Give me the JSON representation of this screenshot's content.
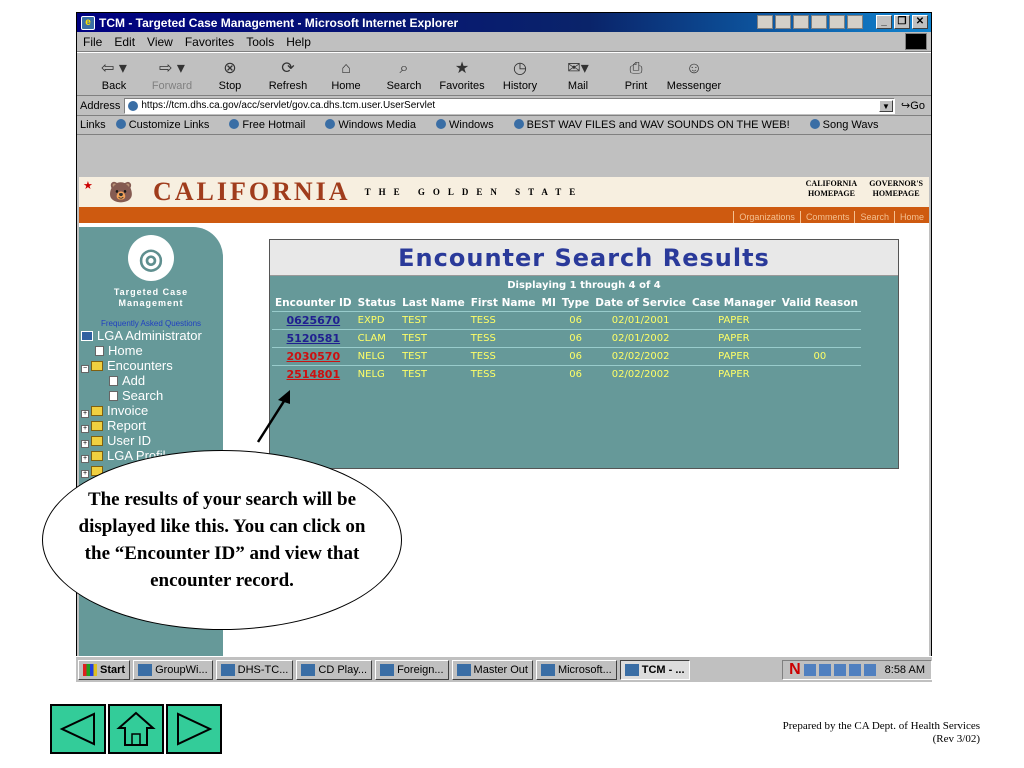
{
  "window": {
    "title": "TCM - Targeted Case Management - Microsoft Internet Explorer"
  },
  "menu": [
    "File",
    "Edit",
    "View",
    "Favorites",
    "Tools",
    "Help"
  ],
  "toolbar": {
    "back": "Back",
    "forward": "Forward",
    "stop": "Stop",
    "refresh": "Refresh",
    "home": "Home",
    "search": "Search",
    "favorites": "Favorites",
    "history": "History",
    "mail": "Mail",
    "print": "Print",
    "messenger": "Messenger"
  },
  "address": {
    "label": "Address",
    "url": "https://tcm.dhs.ca.gov/acc/servlet/gov.ca.dhs.tcm.user.UserServlet",
    "go": "Go"
  },
  "links": {
    "label": "Links",
    "items": [
      "Customize Links",
      "Free Hotmail",
      "Windows Media",
      "Windows",
      "BEST WAV FILES and WAV SOUNDS ON THE WEB!",
      "Song Wavs"
    ]
  },
  "header": {
    "title": "CALIFORNIA",
    "subtitle": "THE GOLDEN STATE",
    "link1_line1": "CALIFORNIA",
    "link1_line2": "HOMEPAGE",
    "link2_line1": "GOVERNOR'S",
    "link2_line2": "HOMEPAGE",
    "nav": [
      "Organizations",
      "Comments",
      "Search",
      "Home"
    ]
  },
  "sidebar": {
    "title_line1": "Targeted Case",
    "title_line2": "Management",
    "faq": "Frequently Asked Questions",
    "items": {
      "admin": "LGA Administrator",
      "home": "Home",
      "encounters": "Encounters",
      "add": "Add",
      "search": "Search",
      "invoice": "Invoice",
      "report": "Report",
      "userid": "User ID",
      "lgaprofile": "LGA Profil"
    }
  },
  "results": {
    "title": "Encounter Search Results",
    "subtitle": "Displaying 1 through 4 of 4",
    "columns": [
      "Encounter ID",
      "Status",
      "Last Name",
      "First Name",
      "MI",
      "Type",
      "Date of Service",
      "Case Manager",
      "Valid Reason"
    ],
    "rows": [
      {
        "id": "0625670",
        "status": "EXPD",
        "last": "TEST",
        "first": "TESS",
        "mi": "",
        "type": "06",
        "date": "02/01/2001",
        "manager": "PAPER",
        "reason": ""
      },
      {
        "id": "5120581",
        "status": "CLAM",
        "last": "TEST",
        "first": "TESS",
        "mi": "",
        "type": "06",
        "date": "02/01/2002",
        "manager": "PAPER",
        "reason": ""
      },
      {
        "id": "2030570",
        "status": "NELG",
        "last": "TEST",
        "first": "TESS",
        "mi": "",
        "type": "06",
        "date": "02/02/2002",
        "manager": "PAPER",
        "reason": "00"
      },
      {
        "id": "2514801",
        "status": "NELG",
        "last": "TEST",
        "first": "TESS",
        "mi": "",
        "type": "06",
        "date": "02/02/2002",
        "manager": "PAPER",
        "reason": ""
      }
    ]
  },
  "callout": {
    "text": "The results of your search will be displayed like this. You can click on the “Encounter ID” and view that encounter record."
  },
  "taskbar": {
    "start": "Start",
    "tasks": [
      "GroupWi...",
      "DHS-TC...",
      "CD Play...",
      "Foreign...",
      "Master Out",
      "Microsoft...",
      "TCM - ..."
    ],
    "clock": "8:58 AM"
  },
  "footer": {
    "line1": "Prepared by the CA Dept. of Health Services",
    "line2": "(Rev 3/02)"
  }
}
